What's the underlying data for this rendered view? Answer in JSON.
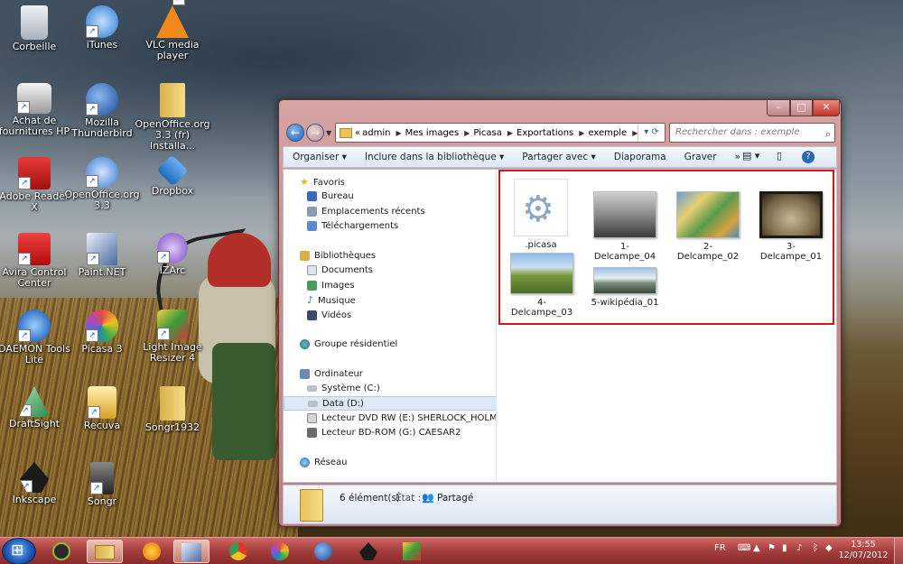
{
  "desktop": {
    "icons": [
      {
        "label": "Corbeille",
        "icon": "recycle-bin-icon",
        "color": "#bfc7cf"
      },
      {
        "label": "iTunes",
        "icon": "itunes-icon",
        "color": "#3a8ee0"
      },
      {
        "label": "VLC media player",
        "icon": "vlc-icon",
        "color": "#f08a1a"
      },
      {
        "label": "Achat de fournitures HP",
        "icon": "hp-printer-icon",
        "color": "#dddddd"
      },
      {
        "label": "Mozilla Thunderbird",
        "icon": "thunderbird-icon",
        "color": "#2a5ab0"
      },
      {
        "label": "OpenOffice.org 3.3 (fr) Installa...",
        "icon": "folder-icon",
        "color": "#e8c45a"
      },
      {
        "label": "Adobe Reader X",
        "icon": "adobe-reader-icon",
        "color": "#c81c1c"
      },
      {
        "label": "OpenOffice.org 3.3",
        "icon": "openoffice-icon",
        "color": "#5a9ae0"
      },
      {
        "label": "Dropbox",
        "icon": "dropbox-icon",
        "color": "#3a8ae0"
      },
      {
        "label": "Avira Control Center",
        "icon": "avira-icon",
        "color": "#d81818"
      },
      {
        "label": "Paint.NET",
        "icon": "paintnet-icon",
        "color": "#4a6aa0"
      },
      {
        "label": "IZArc",
        "icon": "izarc-icon",
        "color": "#9a6ad0"
      },
      {
        "label": "DAEMON Tools Lite",
        "icon": "daemon-tools-icon",
        "color": "#1a6ad0"
      },
      {
        "label": "Picasa 3",
        "icon": "picasa-icon",
        "color": "#e04a8a"
      },
      {
        "label": "Light Image Resizer 4",
        "icon": "light-image-resizer-icon",
        "color": "#e0a02a"
      },
      {
        "label": "DraftSight",
        "icon": "draftsight-icon",
        "color": "#3a9a5a"
      },
      {
        "label": "Recuva",
        "icon": "recuva-icon",
        "color": "#e8c040"
      },
      {
        "label": "Songr1932",
        "icon": "folder-icon",
        "color": "#e8c45a"
      },
      {
        "label": "Inkscape",
        "icon": "inkscape-icon",
        "color": "#1a1a1a"
      },
      {
        "label": "Songr",
        "icon": "songr-icon",
        "color": "#2a2a2a"
      }
    ]
  },
  "window": {
    "address": {
      "prefix": "«",
      "segments": [
        "admin",
        "Mes images",
        "Picasa",
        "Exportations",
        "exemple"
      ]
    },
    "search_placeholder": "Rechercher dans : exemple",
    "toolbar": {
      "organize": "Organiser ▾",
      "include": "Inclure dans la bibliothèque ▾",
      "share": "Partager avec ▾",
      "slideshow": "Diaporama",
      "burn": "Graver",
      "more": "»"
    },
    "nav": {
      "favorites": "Favoris",
      "desktop": "Bureau",
      "recent": "Emplacements récents",
      "downloads": "Téléchargements",
      "libraries": "Bibliothèques",
      "documents": "Documents",
      "images": "Images",
      "music": "Musique",
      "videos": "Vidéos",
      "homegroup": "Groupe résidentiel",
      "computer": "Ordinateur",
      "drive_c": "Système (C:)",
      "drive_d": "Data (D:)",
      "drive_e": "Lecteur DVD RW (E:) SHERLOCK_HOLMES_VS_J",
      "drive_g": "Lecteur BD-ROM (G:) CAESAR2",
      "network": "Réseau"
    },
    "files": [
      {
        "name": ".picasa",
        "kind": "settings-file"
      },
      {
        "name": "1-Delcampe_04",
        "kind": "image"
      },
      {
        "name": "2-Delcampe_02",
        "kind": "image"
      },
      {
        "name": "3-Delcampe_01",
        "kind": "image"
      },
      {
        "name": "4-Delcampe_03",
        "kind": "image"
      },
      {
        "name": "5-wikipédia_01",
        "kind": "image"
      }
    ],
    "details": {
      "count": "6 élément(s)",
      "state_label": "État :",
      "state_value": "Partagé"
    }
  },
  "taskbar": {
    "language": "FR",
    "time": "13:55",
    "date": "12/07/2012",
    "apps": [
      "spotify-icon",
      "explorer-icon",
      "media-player-icon",
      "paintnet-icon",
      "chrome-icon",
      "picasa-icon",
      "thunderbird-icon",
      "inkscape-icon",
      "light-image-resizer-icon"
    ]
  },
  "colors": {
    "window_frame": "#c98c8c",
    "selection_border": "#d01818",
    "taskbar": "#a84040"
  }
}
